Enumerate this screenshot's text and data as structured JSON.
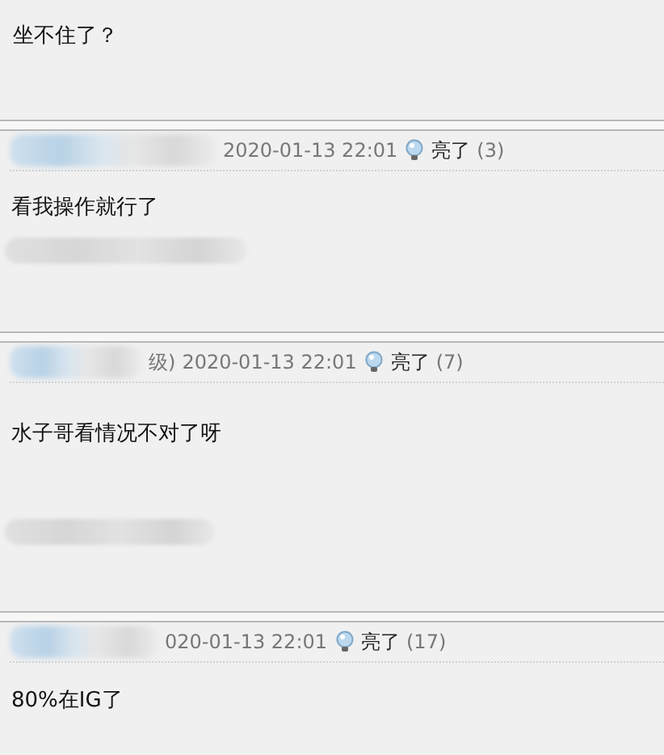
{
  "opening_reply": {
    "text": "坐不住了？"
  },
  "replies": [
    {
      "date": "2020-01-13 22:01",
      "light_label": "亮了",
      "light_count": "(3)",
      "text": "看我操作就行了",
      "blurred_signature": true
    },
    {
      "author_tail": "级)",
      "date": "2020-01-13 22:01",
      "light_label": "亮了",
      "light_count": "(7)",
      "text": "水子哥看情况不对了呀",
      "blurred_signature": true
    },
    {
      "date": "020-01-13 22:01",
      "light_label": "亮了",
      "light_count": "(17)",
      "text": "80%在IG了",
      "blurred_signature": false
    }
  ]
}
